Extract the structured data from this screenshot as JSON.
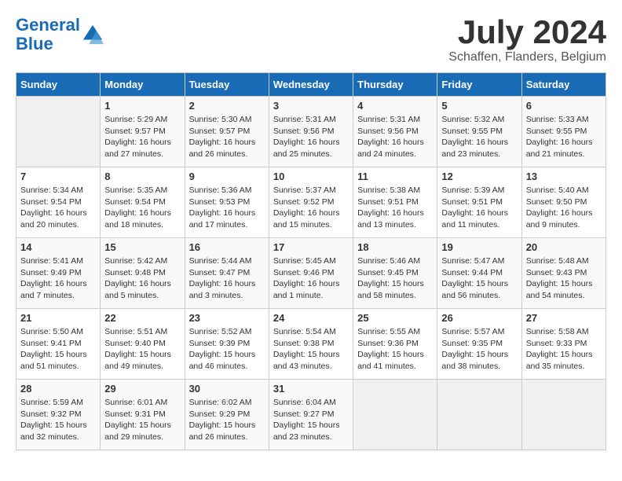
{
  "header": {
    "logo_line1": "General",
    "logo_line2": "Blue",
    "month": "July 2024",
    "location": "Schaffen, Flanders, Belgium"
  },
  "days_of_week": [
    "Sunday",
    "Monday",
    "Tuesday",
    "Wednesday",
    "Thursday",
    "Friday",
    "Saturday"
  ],
  "weeks": [
    [
      {
        "day": "",
        "info": ""
      },
      {
        "day": "1",
        "info": "Sunrise: 5:29 AM\nSunset: 9:57 PM\nDaylight: 16 hours\nand 27 minutes."
      },
      {
        "day": "2",
        "info": "Sunrise: 5:30 AM\nSunset: 9:57 PM\nDaylight: 16 hours\nand 26 minutes."
      },
      {
        "day": "3",
        "info": "Sunrise: 5:31 AM\nSunset: 9:56 PM\nDaylight: 16 hours\nand 25 minutes."
      },
      {
        "day": "4",
        "info": "Sunrise: 5:31 AM\nSunset: 9:56 PM\nDaylight: 16 hours\nand 24 minutes."
      },
      {
        "day": "5",
        "info": "Sunrise: 5:32 AM\nSunset: 9:55 PM\nDaylight: 16 hours\nand 23 minutes."
      },
      {
        "day": "6",
        "info": "Sunrise: 5:33 AM\nSunset: 9:55 PM\nDaylight: 16 hours\nand 21 minutes."
      }
    ],
    [
      {
        "day": "7",
        "info": "Sunrise: 5:34 AM\nSunset: 9:54 PM\nDaylight: 16 hours\nand 20 minutes."
      },
      {
        "day": "8",
        "info": "Sunrise: 5:35 AM\nSunset: 9:54 PM\nDaylight: 16 hours\nand 18 minutes."
      },
      {
        "day": "9",
        "info": "Sunrise: 5:36 AM\nSunset: 9:53 PM\nDaylight: 16 hours\nand 17 minutes."
      },
      {
        "day": "10",
        "info": "Sunrise: 5:37 AM\nSunset: 9:52 PM\nDaylight: 16 hours\nand 15 minutes."
      },
      {
        "day": "11",
        "info": "Sunrise: 5:38 AM\nSunset: 9:51 PM\nDaylight: 16 hours\nand 13 minutes."
      },
      {
        "day": "12",
        "info": "Sunrise: 5:39 AM\nSunset: 9:51 PM\nDaylight: 16 hours\nand 11 minutes."
      },
      {
        "day": "13",
        "info": "Sunrise: 5:40 AM\nSunset: 9:50 PM\nDaylight: 16 hours\nand 9 minutes."
      }
    ],
    [
      {
        "day": "14",
        "info": "Sunrise: 5:41 AM\nSunset: 9:49 PM\nDaylight: 16 hours\nand 7 minutes."
      },
      {
        "day": "15",
        "info": "Sunrise: 5:42 AM\nSunset: 9:48 PM\nDaylight: 16 hours\nand 5 minutes."
      },
      {
        "day": "16",
        "info": "Sunrise: 5:44 AM\nSunset: 9:47 PM\nDaylight: 16 hours\nand 3 minutes."
      },
      {
        "day": "17",
        "info": "Sunrise: 5:45 AM\nSunset: 9:46 PM\nDaylight: 16 hours\nand 1 minute."
      },
      {
        "day": "18",
        "info": "Sunrise: 5:46 AM\nSunset: 9:45 PM\nDaylight: 15 hours\nand 58 minutes."
      },
      {
        "day": "19",
        "info": "Sunrise: 5:47 AM\nSunset: 9:44 PM\nDaylight: 15 hours\nand 56 minutes."
      },
      {
        "day": "20",
        "info": "Sunrise: 5:48 AM\nSunset: 9:43 PM\nDaylight: 15 hours\nand 54 minutes."
      }
    ],
    [
      {
        "day": "21",
        "info": "Sunrise: 5:50 AM\nSunset: 9:41 PM\nDaylight: 15 hours\nand 51 minutes."
      },
      {
        "day": "22",
        "info": "Sunrise: 5:51 AM\nSunset: 9:40 PM\nDaylight: 15 hours\nand 49 minutes."
      },
      {
        "day": "23",
        "info": "Sunrise: 5:52 AM\nSunset: 9:39 PM\nDaylight: 15 hours\nand 46 minutes."
      },
      {
        "day": "24",
        "info": "Sunrise: 5:54 AM\nSunset: 9:38 PM\nDaylight: 15 hours\nand 43 minutes."
      },
      {
        "day": "25",
        "info": "Sunrise: 5:55 AM\nSunset: 9:36 PM\nDaylight: 15 hours\nand 41 minutes."
      },
      {
        "day": "26",
        "info": "Sunrise: 5:57 AM\nSunset: 9:35 PM\nDaylight: 15 hours\nand 38 minutes."
      },
      {
        "day": "27",
        "info": "Sunrise: 5:58 AM\nSunset: 9:33 PM\nDaylight: 15 hours\nand 35 minutes."
      }
    ],
    [
      {
        "day": "28",
        "info": "Sunrise: 5:59 AM\nSunset: 9:32 PM\nDaylight: 15 hours\nand 32 minutes."
      },
      {
        "day": "29",
        "info": "Sunrise: 6:01 AM\nSunset: 9:31 PM\nDaylight: 15 hours\nand 29 minutes."
      },
      {
        "day": "30",
        "info": "Sunrise: 6:02 AM\nSunset: 9:29 PM\nDaylight: 15 hours\nand 26 minutes."
      },
      {
        "day": "31",
        "info": "Sunrise: 6:04 AM\nSunset: 9:27 PM\nDaylight: 15 hours\nand 23 minutes."
      },
      {
        "day": "",
        "info": ""
      },
      {
        "day": "",
        "info": ""
      },
      {
        "day": "",
        "info": ""
      }
    ]
  ]
}
